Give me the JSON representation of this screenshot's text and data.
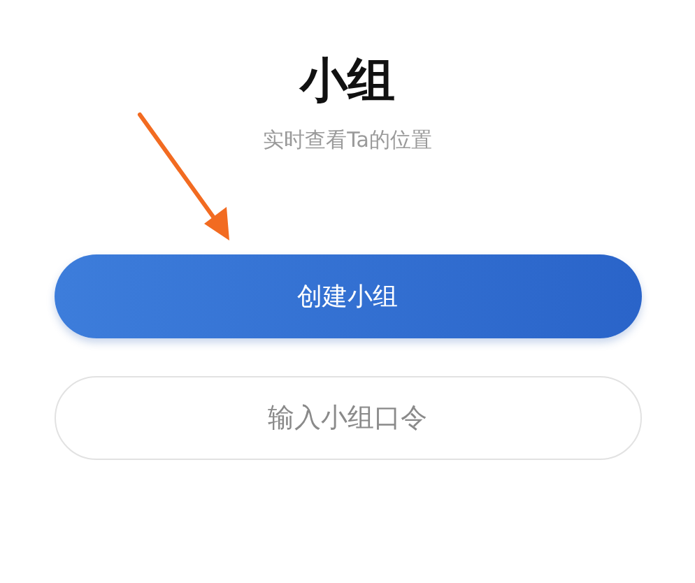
{
  "header": {
    "title": "小组",
    "subtitle": "实时查看Ta的位置"
  },
  "buttons": [
    {
      "label": "创建小组",
      "kind": "primary"
    },
    {
      "label": "输入小组口令",
      "kind": "secondary"
    }
  ]
}
